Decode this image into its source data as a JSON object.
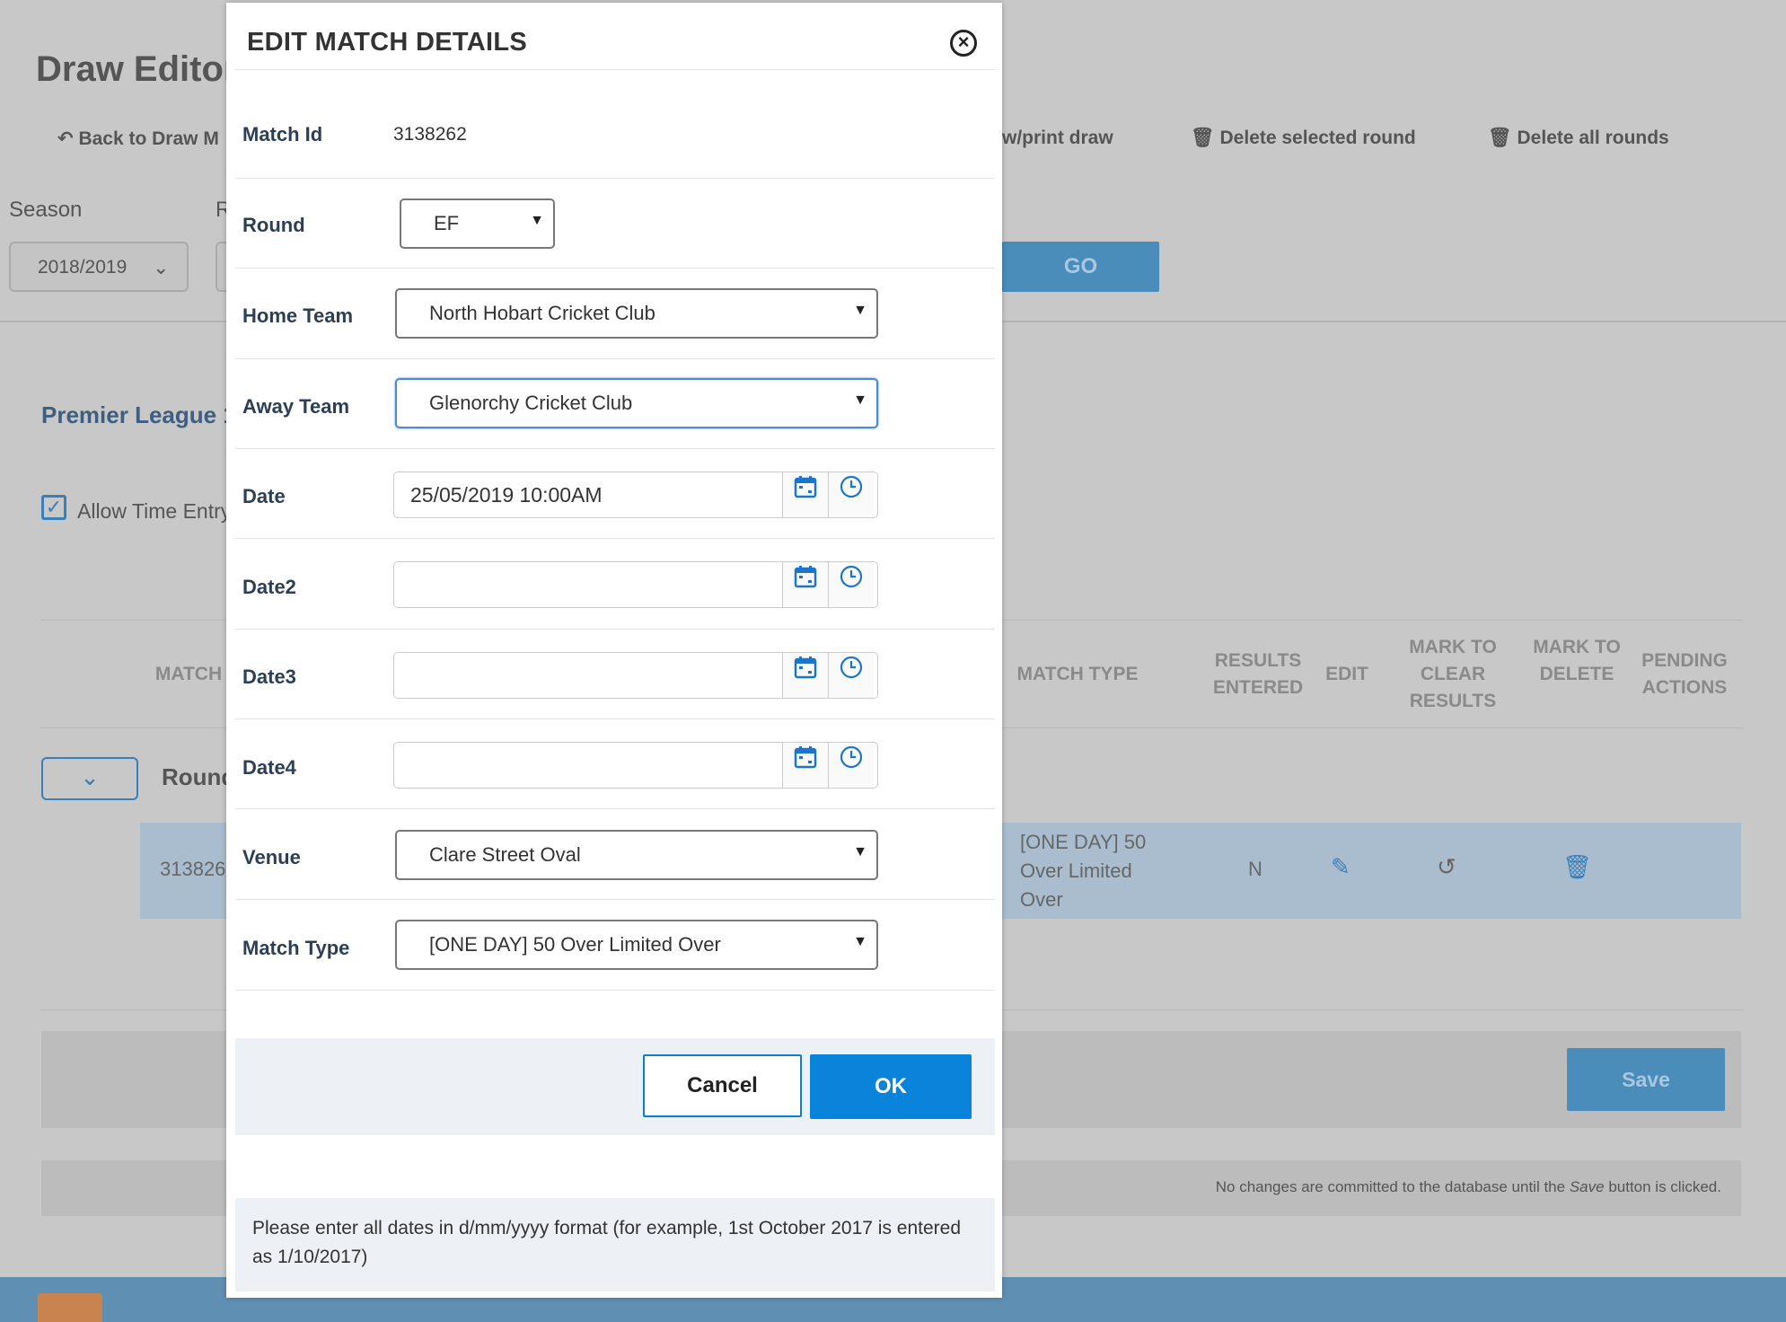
{
  "background": {
    "page_title": "Draw Editor",
    "links": {
      "back": "Back to Draw M",
      "view_print": "w/print draw",
      "delete_selected_round": "Delete selected round",
      "delete_all_rounds": "Delete all rounds"
    },
    "season_label": "Season",
    "second_label": "R",
    "season_value": "2018/2019",
    "go_label": "GO",
    "section_title": "Premier League 1",
    "allow_time_entry": "Allow Time Entry",
    "table": {
      "headers": {
        "match": "MATCH",
        "match_type": "MATCH TYPE",
        "results_entered": "RESULTS ENTERED",
        "edit": "EDIT",
        "mark_to_clear_results": "MARK TO CLEAR RESULTS",
        "mark_to_delete": "MARK TO DELETE",
        "pending_actions": "PENDING ACTIONS"
      },
      "round_label": "Round",
      "row": {
        "match_id": "313826",
        "match_type": "[ONE DAY] 50 Over Limited Over",
        "results_entered": "N"
      }
    },
    "save_label": "Save",
    "note": {
      "prefix": "No changes are committed to the database until the",
      "emph": "Save",
      "suffix": "button is clicked."
    }
  },
  "modal": {
    "title": "EDIT MATCH DETAILS",
    "fields": {
      "match_id": {
        "label": "Match Id",
        "value": "3138262"
      },
      "round": {
        "label": "Round",
        "value": "EF"
      },
      "home_team": {
        "label": "Home Team",
        "value": "North Hobart Cricket Club"
      },
      "away_team": {
        "label": "Away Team",
        "value": "Glenorchy Cricket Club"
      },
      "date": {
        "label": "Date",
        "value": "25/05/2019 10:00AM"
      },
      "date2": {
        "label": "Date2",
        "value": ""
      },
      "date3": {
        "label": "Date3",
        "value": ""
      },
      "date4": {
        "label": "Date4",
        "value": ""
      },
      "venue": {
        "label": "Venue",
        "value": "Clare Street Oval"
      },
      "match_type": {
        "label": "Match Type",
        "value": "[ONE DAY] 50 Over Limited Over"
      }
    },
    "buttons": {
      "cancel": "Cancel",
      "ok": "OK"
    },
    "note": "Please enter all dates in d/mm/yyyy format (for example, 1st October 2017 is entered as 1/10/2017)"
  },
  "icons": {
    "close": "close-circle-icon",
    "calendar": "calendar-icon",
    "clock": "clock-icon",
    "dropdown": "caret-down-icon",
    "back": "reply-arrow-icon",
    "trash": "trash-icon",
    "pencil": "pencil-icon",
    "undo": "undo-icon"
  },
  "colors": {
    "primary": "#0a83db",
    "overlay_bg": "#c8c8c8",
    "footer_bar": "#5f8fb3",
    "heading": "#2d3f55"
  }
}
